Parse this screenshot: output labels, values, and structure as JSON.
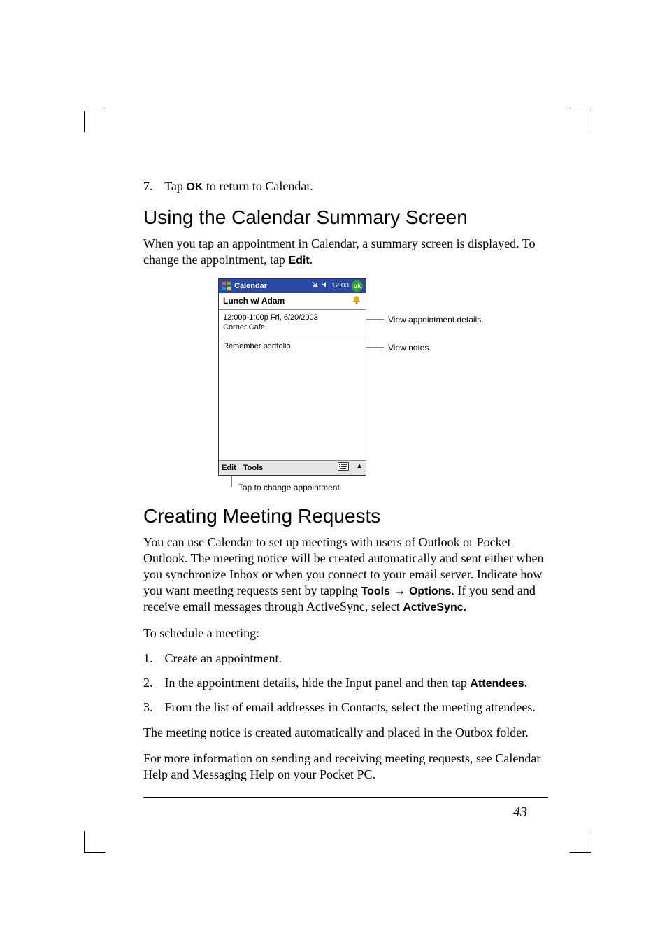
{
  "step7": {
    "num": "7.",
    "pre": "Tap ",
    "bold": "OK",
    "post": " to return to Calendar."
  },
  "section1": {
    "heading": "Using the Calendar Summary Screen",
    "para_pre": "When you tap an appointment in Calendar, a summary screen is displayed. To change the appointment, tap ",
    "para_bold": "Edit",
    "para_post": "."
  },
  "figure": {
    "title": "Calendar",
    "clock": "12:03",
    "ok": "ok",
    "subject": "Lunch w/ Adam",
    "detail_line1": "12:00p-1:00p Fri, 6/20/2003",
    "detail_line2": "Corner Cafe",
    "notes": "Remember portfolio.",
    "menu_edit": "Edit",
    "menu_tools": "Tools",
    "callout_details": "View appointment details.",
    "callout_notes": "View notes.",
    "callout_edit": "Tap to change appointment."
  },
  "section2": {
    "heading": "Creating Meeting Requests",
    "p1_a": "You can use Calendar to set up meetings with users of Outlook or Pocket Outlook. The meeting notice will be created automatically and sent either when you synchronize Inbox or when you connect to your email server. Indicate how you want meeting requests sent by tapping ",
    "p1_b1": "Tools",
    "p1_arrow": " → ",
    "p1_b2": "Options",
    "p1_c": ". If you send and receive email messages through ActiveSync, select ",
    "p1_b3": "ActiveSync.",
    "p2": "To schedule a meeting:",
    "li1": {
      "num": "1.",
      "text": "Create an appointment."
    },
    "li2": {
      "num": "2.",
      "pre": "In the appointment details, hide the Input panel and then tap ",
      "bold": "Attendees",
      "post": "."
    },
    "li3": {
      "num": "3.",
      "text": "From the list of email addresses in Contacts, select the meeting attendees."
    },
    "p3": "The meeting notice is created automatically and placed in the Outbox folder.",
    "p4": "For more information on sending and receiving meeting requests, see Calendar Help and Messaging Help on your Pocket PC."
  },
  "page_number": "43"
}
